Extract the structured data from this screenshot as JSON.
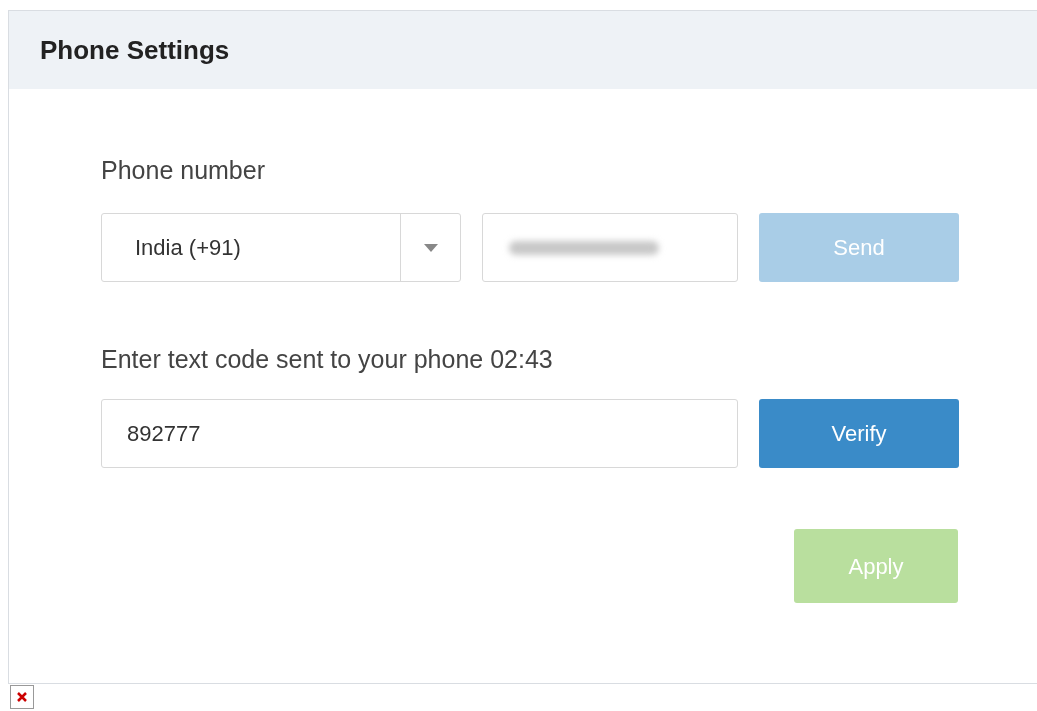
{
  "panel": {
    "title": "Phone Settings"
  },
  "phone": {
    "label": "Phone number",
    "country": "India (+91)",
    "number_redacted": true,
    "send": {
      "label": "Send",
      "disabled": true
    }
  },
  "code": {
    "label": "Enter text code sent to your phone 02:43",
    "value": "892777",
    "verify": {
      "label": "Verify",
      "disabled": false
    }
  },
  "apply": {
    "label": "Apply",
    "disabled": true
  },
  "broken_image": true
}
